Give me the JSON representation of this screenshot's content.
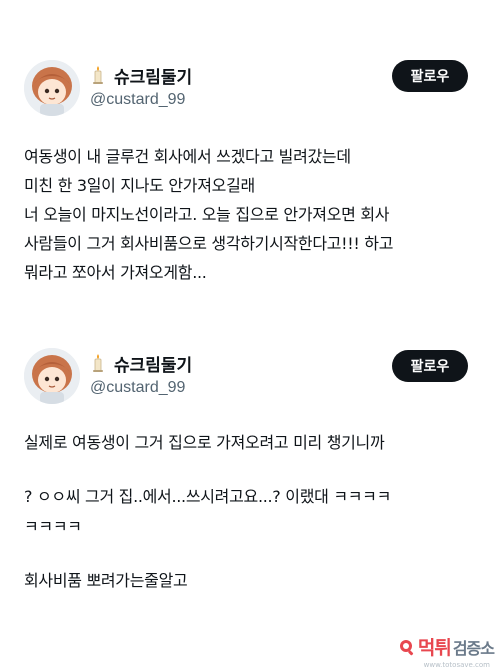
{
  "tweets": [
    {
      "display_name": "슈크림둘기",
      "handle": "@custard_99",
      "follow_label": "팔로우",
      "lines": [
        "여동생이 내 글루건 회사에서 쓰겠다고 빌려갔는데",
        "미친 한 3일이 지나도 안가져오길래",
        "너 오늘이 마지노선이라고. 오늘 집으로 안가져오면 회사",
        "사람들이 그거 회사비품으로 생각하기시작한다고!!! 하고",
        "뭐라고 쪼아서 가져오게함..."
      ]
    },
    {
      "display_name": "슈크림둘기",
      "handle": "@custard_99",
      "follow_label": "팔로우",
      "lines": [
        "실제로 여동생이 그거 집으로 가져오려고 미리 챙기니까",
        "? ㅇㅇ씨 그거 집..에서...쓰시려고요...? 이랬대 ㅋㅋㅋㅋ",
        "ㅋㅋㅋㅋ",
        "회사비품 뽀려가는줄알고"
      ]
    }
  ],
  "watermark": {
    "brand": "먹튀",
    "sub": "검증소",
    "url": "www.totosave.com"
  },
  "colors": {
    "text": "#0f1419",
    "secondary": "#536471",
    "follow_bg": "#0f1419",
    "watermark_red": "#e8474f"
  },
  "icons": [
    "candle-icon",
    "avatar",
    "search-magnifier-icon"
  ]
}
